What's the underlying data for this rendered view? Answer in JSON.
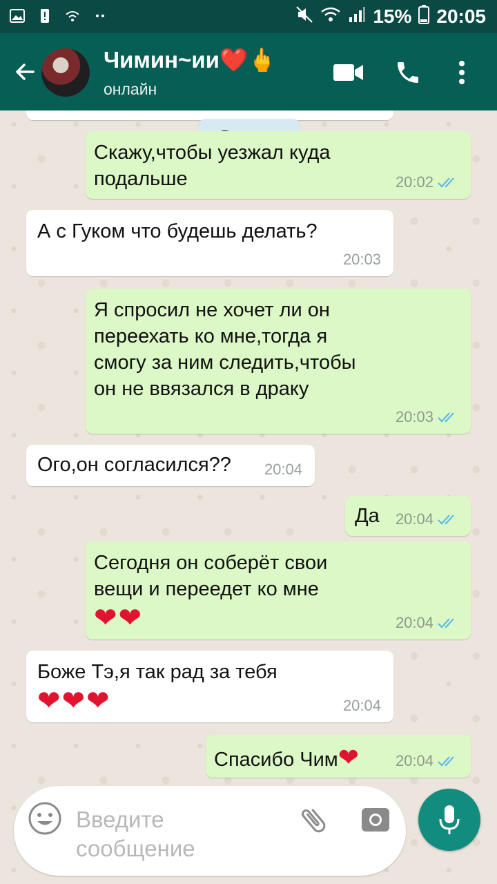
{
  "status_bar": {
    "battery": "15%",
    "time": "20:05"
  },
  "header": {
    "contact_name": "Чимин~ии❤️🖕",
    "status": "онлайн"
  },
  "chat": {
    "date_label": "Сегодня",
    "messages": [
      {
        "direction": "out",
        "text": "Скажу,чтобы уезжал куда подальше",
        "time": "20:02"
      },
      {
        "direction": "in",
        "text": "А с Гуком что будешь делать?",
        "time": "20:03"
      },
      {
        "direction": "out",
        "text": "Я спросил не хочет ли он переехать ко мне,тогда я смогу за ним следить,чтобы он не ввязался в драку",
        "time": "20:03"
      },
      {
        "direction": "in",
        "text": "Ого,он согласился??",
        "time": "20:04"
      },
      {
        "direction": "out",
        "text": "Да",
        "time": "20:04"
      },
      {
        "direction": "out",
        "text": "Сегодня он соберёт свои вещи и переедет ко мне",
        "emoji": "❤❤",
        "time": "20:04"
      },
      {
        "direction": "in",
        "text": "Боже Тэ,я так рад за тебя",
        "emoji": "❤❤❤",
        "time": "20:04"
      },
      {
        "direction": "out",
        "text": "Спасибо Чим",
        "emoji": "❤",
        "time": "20:04"
      }
    ]
  },
  "composer": {
    "placeholder": "Введите сообщение"
  },
  "icons": {
    "back": "arrow-left-icon",
    "video": "video-call-icon",
    "call": "phone-icon",
    "menu": "more-vert-icon",
    "emoji": "emoji-icon",
    "attach": "paperclip-icon",
    "camera": "camera-icon",
    "mic": "mic-icon"
  },
  "colors": {
    "app_bar": "#075e54",
    "outgoing_bubble": "#dcf8c6",
    "incoming_bubble": "#ffffff",
    "read_ticks": "#4fb6ec",
    "mic_button": "#128c7e"
  }
}
